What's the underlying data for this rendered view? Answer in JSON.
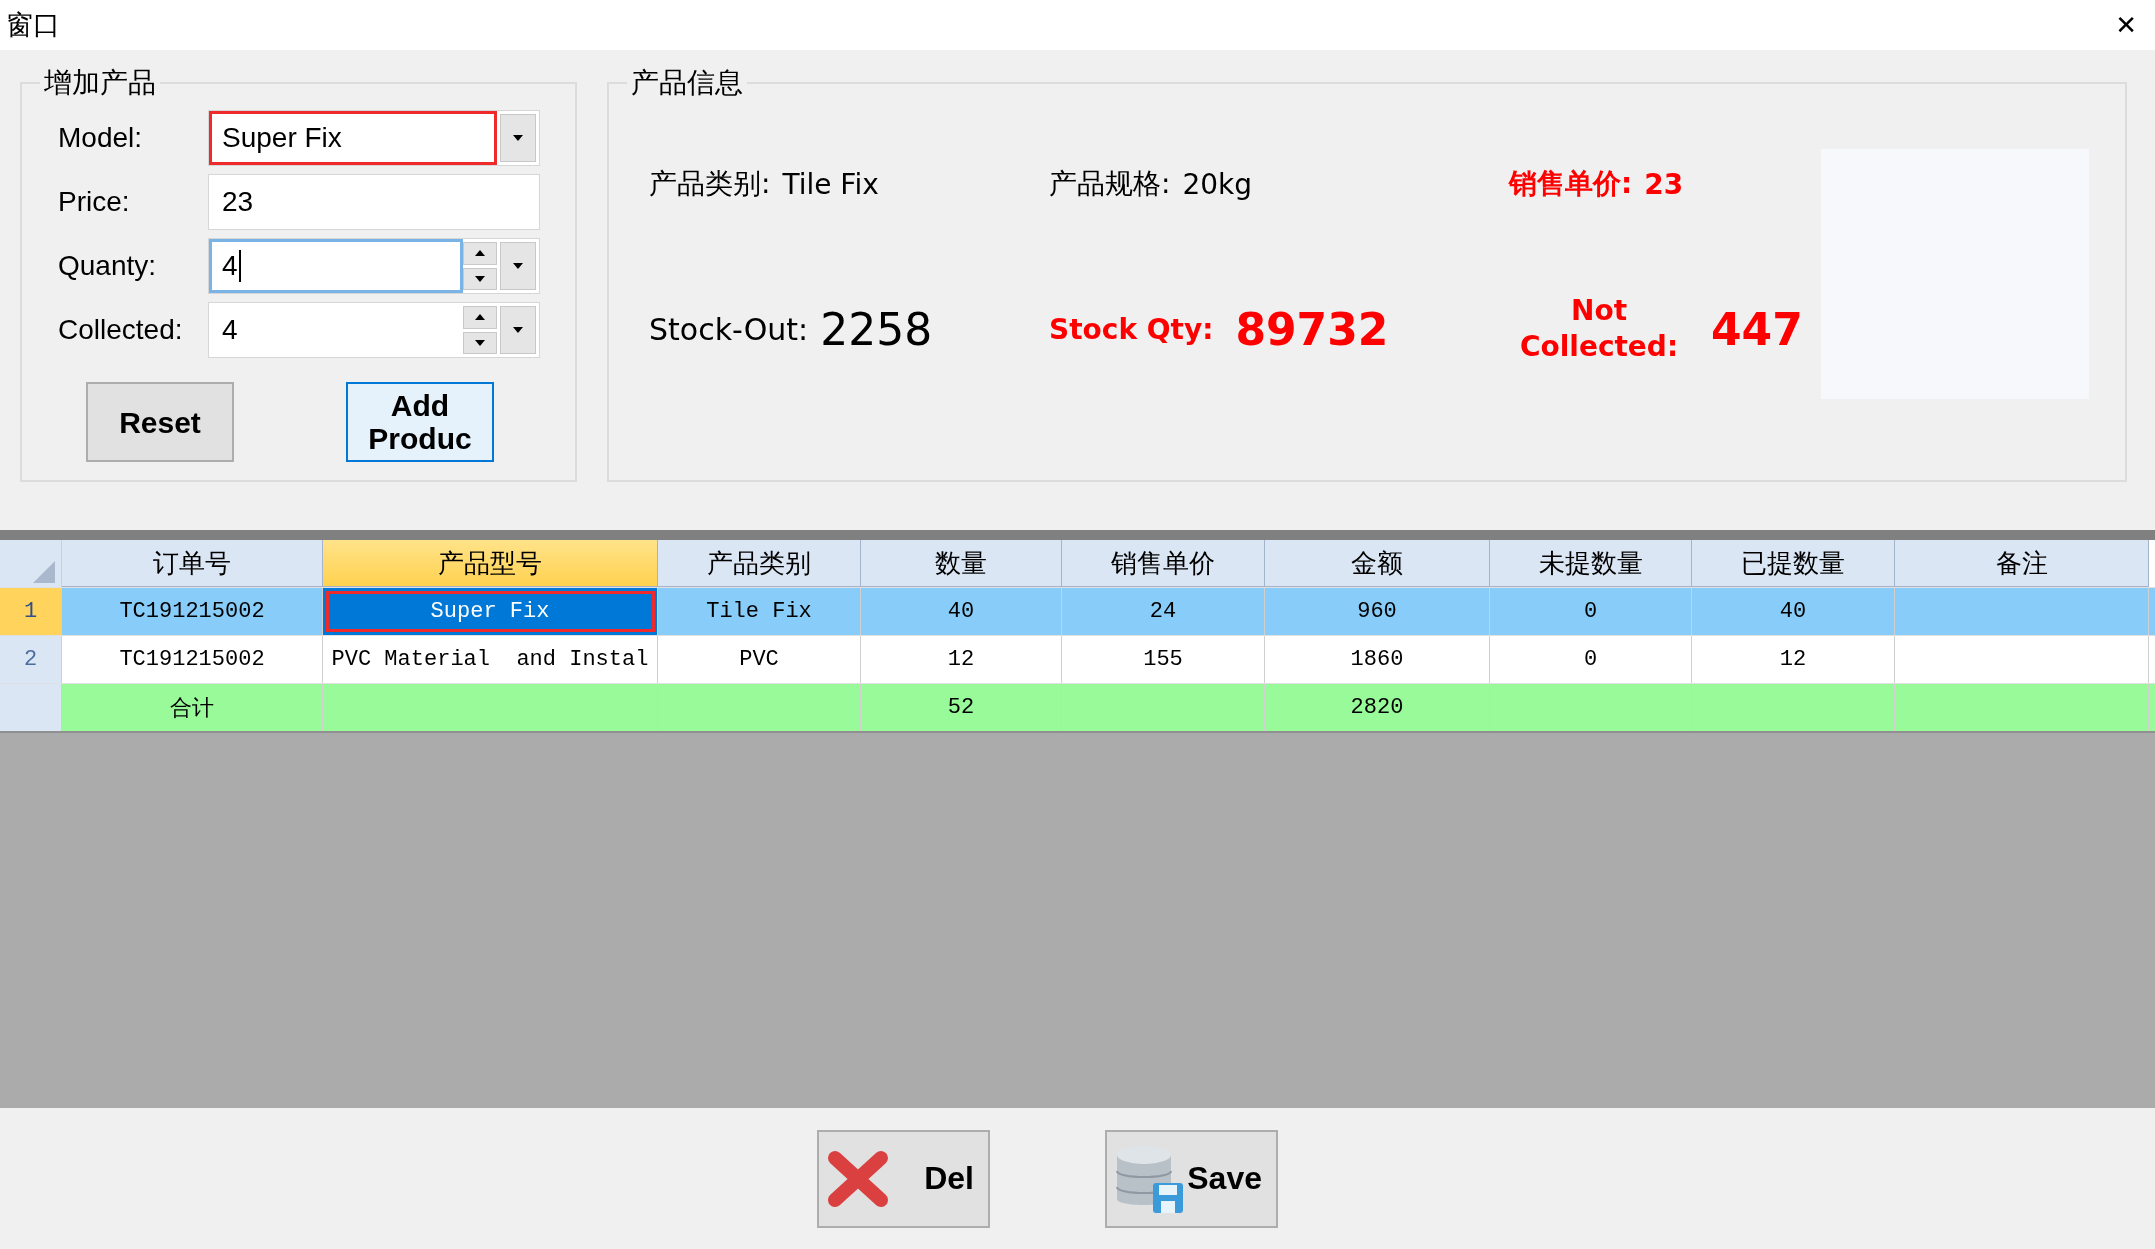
{
  "window": {
    "title": "窗口",
    "close": "✕"
  },
  "add_product": {
    "title": "增加产品",
    "fields": [
      {
        "label": "Model:",
        "kind": "combo",
        "value": "Super Fix",
        "highlighted": true,
        "focused": false
      },
      {
        "label": "Price:",
        "kind": "text",
        "value": "23",
        "highlighted": false,
        "focused": false
      },
      {
        "label": "Quanty:",
        "kind": "spin",
        "value": "4",
        "highlighted": false,
        "focused": true
      },
      {
        "label": "Collected:",
        "kind": "spin",
        "value": "4",
        "highlighted": false,
        "focused": false
      }
    ],
    "buttons": [
      {
        "label": "Reset",
        "focused": false
      },
      {
        "label": "Add Produc",
        "focused": true
      }
    ]
  },
  "product_info": {
    "title": "产品信息",
    "items": [
      {
        "kind": "detail",
        "alert": false,
        "label": "产品类别:",
        "value": "Tile Fix"
      },
      {
        "kind": "detail",
        "alert": false,
        "label": "产品规格:",
        "value": "20kg"
      },
      {
        "kind": "detail",
        "alert": true,
        "label": "销售单价:",
        "value": "23"
      },
      {
        "kind": "figure",
        "alert": false,
        "label": "Stock-Out:",
        "value": "2258"
      },
      {
        "kind": "figure",
        "alert": true,
        "label": "Stock Qty:",
        "value": "89732"
      },
      {
        "kind": "figure",
        "alert": true,
        "label": "Not Collected:",
        "value": "447"
      }
    ]
  },
  "table": {
    "columns": [
      {
        "label": "订单号",
        "selected": false
      },
      {
        "label": "产品型号",
        "selected": true
      },
      {
        "label": "产品类别",
        "selected": false
      },
      {
        "label": "数量",
        "selected": false
      },
      {
        "label": "销售单价",
        "selected": false
      },
      {
        "label": "金额",
        "selected": false
      },
      {
        "label": "未提数量",
        "selected": false
      },
      {
        "label": "已提数量",
        "selected": false
      },
      {
        "label": "备注",
        "selected": false
      }
    ],
    "rows": [
      {
        "kind": "data",
        "header": "1",
        "selected": true,
        "cells": [
          {
            "text": "TC191215002",
            "selected": false
          },
          {
            "text": "Super Fix",
            "selected": true
          },
          {
            "text": "Tile Fix",
            "selected": false
          },
          {
            "text": "40",
            "selected": false
          },
          {
            "text": "24",
            "selected": false
          },
          {
            "text": "960",
            "selected": false
          },
          {
            "text": "0",
            "selected": false
          },
          {
            "text": "40",
            "selected": false
          },
          {
            "text": "",
            "selected": false
          }
        ]
      },
      {
        "kind": "data",
        "header": "2",
        "selected": false,
        "cells": [
          {
            "text": "TC191215002",
            "selected": false
          },
          {
            "text": "PVC Material  and Instal",
            "selected": false
          },
          {
            "text": "PVC",
            "selected": false
          },
          {
            "text": "12",
            "selected": false
          },
          {
            "text": "155",
            "selected": false
          },
          {
            "text": "1860",
            "selected": false
          },
          {
            "text": "0",
            "selected": false
          },
          {
            "text": "12",
            "selected": false
          },
          {
            "text": "",
            "selected": false
          }
        ]
      },
      {
        "kind": "total",
        "header": "",
        "selected": false,
        "cells": [
          {
            "text": "合计",
            "selected": false
          },
          {
            "text": "",
            "selected": false
          },
          {
            "text": "",
            "selected": false
          },
          {
            "text": "52",
            "selected": false
          },
          {
            "text": "",
            "selected": false
          },
          {
            "text": "2820",
            "selected": false
          },
          {
            "text": "",
            "selected": false
          },
          {
            "text": "",
            "selected": false
          },
          {
            "text": "",
            "selected": false
          }
        ]
      }
    ]
  },
  "actions": [
    {
      "kind": "delete",
      "label": "Del"
    },
    {
      "kind": "save",
      "label": "Save"
    }
  ]
}
